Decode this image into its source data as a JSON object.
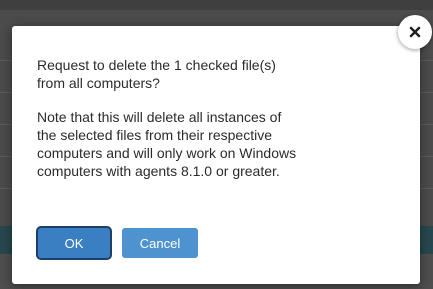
{
  "dialog": {
    "message_1": "Request to delete the 1 checked file(s)\nfrom all computers?",
    "message_2": "Note that this will delete all instances of\nthe selected files from their respective\ncomputers and will only work on Windows\ncomputers with agents 8.1.0 or greater.",
    "ok_label": "OK",
    "cancel_label": "Cancel",
    "close_icon": "close-icon"
  },
  "colors": {
    "ok_button": "#3a7fc1",
    "cancel_button": "#4e93d0",
    "overlay": "#4b4b4b"
  }
}
